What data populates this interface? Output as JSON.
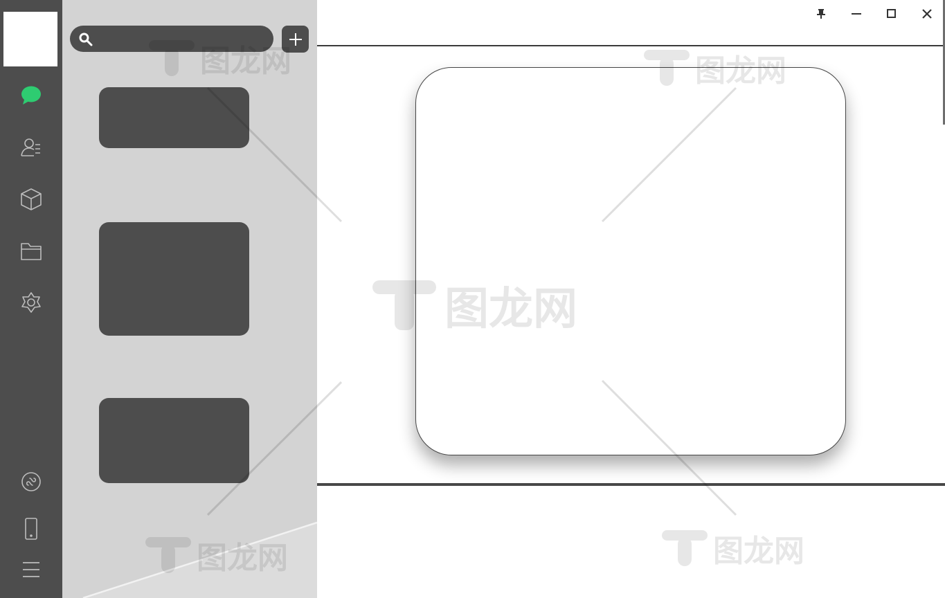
{
  "window": {
    "controls": [
      {
        "id": "pin",
        "icon": "pin-icon"
      },
      {
        "id": "minimize",
        "icon": "minimize-icon"
      },
      {
        "id": "maximize",
        "icon": "maximize-icon"
      },
      {
        "id": "close",
        "icon": "close-icon"
      }
    ]
  },
  "nav_rail": {
    "items": [
      {
        "icon": "chat-bubble-icon",
        "active": true,
        "color": "#2ecc71"
      },
      {
        "icon": "contacts-icon",
        "active": false
      },
      {
        "icon": "cube-icon",
        "active": false
      },
      {
        "icon": "folder-icon",
        "active": false
      },
      {
        "icon": "settings-icon",
        "active": false
      }
    ],
    "bottom_items": [
      {
        "icon": "mini-program-icon"
      },
      {
        "icon": "phone-icon"
      },
      {
        "icon": "menu-icon"
      }
    ]
  },
  "search": {
    "value": "",
    "placeholder": ""
  },
  "colors": {
    "rail": "#4d4d4d",
    "panel": "#d3d3d3",
    "accent": "#2ecc71",
    "card": "#4d4d4d"
  },
  "watermark": {
    "text": "图龙网"
  }
}
